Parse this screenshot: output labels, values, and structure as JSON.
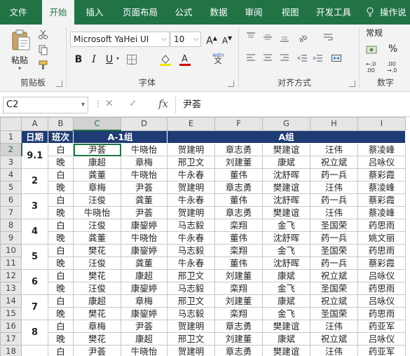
{
  "ribbon_tabs": [
    {
      "label": "文件",
      "active": false
    },
    {
      "label": "开始",
      "active": true
    },
    {
      "label": "插入",
      "active": false
    },
    {
      "label": "页面布局",
      "active": false
    },
    {
      "label": "公式",
      "active": false
    },
    {
      "label": "数据",
      "active": false
    },
    {
      "label": "审阅",
      "active": false
    },
    {
      "label": "视图",
      "active": false
    },
    {
      "label": "开发工具",
      "active": false
    }
  ],
  "tell_me": "操作说",
  "clipboard": {
    "paste_label": "粘贴",
    "group_label": "剪贴板"
  },
  "font": {
    "name": "Microsoft YaHei UI",
    "size": "10",
    "bold": "B",
    "italic": "I",
    "underline": "U",
    "grow": "A",
    "shrink": "A",
    "wen": "wén",
    "group_label": "字体"
  },
  "alignment": {
    "group_label": "对齐方式"
  },
  "number": {
    "format": "常规",
    "percent": "%",
    "group_label": "数字"
  },
  "formula_bar": {
    "name_box": "C2",
    "fx": "fx",
    "value": "尹荟"
  },
  "colors": {
    "accent": "#217346",
    "header_fill": "#1f3b73"
  },
  "columns": [
    "A",
    "B",
    "C",
    "D",
    "E",
    "F",
    "G",
    "H",
    "I"
  ],
  "rows": [
    "1",
    "2",
    "3",
    "4",
    "5",
    "6",
    "7",
    "8",
    "9",
    "10",
    "11",
    "12",
    "13",
    "14",
    "15",
    "16",
    "17",
    "18"
  ],
  "table": {
    "headers": {
      "date": "日期",
      "shift": "班次",
      "group_a1": "A-1组",
      "group_a": "A组"
    },
    "days": [
      {
        "date": "9.1",
        "shifts": [
          {
            "shift": "白",
            "names": [
              "尹荟",
              "牛晓怡",
              "贺建明",
              "章志勇",
              "樊建谊",
              "汪伟",
              "蔡凌峰"
            ]
          },
          {
            "shift": "晚",
            "names": [
              "康超",
              "章梅",
              "邢卫文",
              "刘建董",
              "康斌",
              "祝立斌",
              "吕咏仪"
            ]
          }
        ]
      },
      {
        "date": "2",
        "shifts": [
          {
            "shift": "白",
            "names": [
              "龚董",
              "牛晓怡",
              "牛永春",
              "董伟",
              "沈舒晖",
              "药一兵",
              "蔡彩霞"
            ]
          },
          {
            "shift": "晚",
            "names": [
              "章梅",
              "尹荟",
              "贺建明",
              "章志勇",
              "樊建谊",
              "汪伟",
              "蔡凌峰"
            ]
          }
        ]
      },
      {
        "date": "3",
        "shifts": [
          {
            "shift": "白",
            "names": [
              "汪俊",
              "龚董",
              "牛永春",
              "董伟",
              "沈舒晖",
              "药一兵",
              "蔡彩霞"
            ]
          },
          {
            "shift": "晚",
            "names": [
              "牛晓怡",
              "尹荟",
              "贺建明",
              "章志勇",
              "樊建谊",
              "汪伟",
              "蔡凌峰"
            ]
          }
        ]
      },
      {
        "date": "4",
        "shifts": [
          {
            "shift": "白",
            "names": [
              "汪俊",
              "康鋆婷",
              "马志毅",
              "栾翔",
              "金飞",
              "圣国荣",
              "药思雨"
            ]
          },
          {
            "shift": "晚",
            "names": [
              "龚董",
              "牛晓怡",
              "牛永春",
              "董伟",
              "沈舒晖",
              "药一兵",
              "姚文丽"
            ]
          }
        ]
      },
      {
        "date": "5",
        "shifts": [
          {
            "shift": "白",
            "names": [
              "樊花",
              "康鋆婷",
              "马志毅",
              "栾翔",
              "金飞",
              "圣国荣",
              "药思雨"
            ]
          },
          {
            "shift": "晚",
            "names": [
              "汪俊",
              "龚董",
              "牛永春",
              "董伟",
              "沈舒晖",
              "药一兵",
              "蔡彩霞"
            ]
          }
        ]
      },
      {
        "date": "6",
        "shifts": [
          {
            "shift": "白",
            "names": [
              "樊花",
              "康超",
              "邢卫文",
              "刘建董",
              "康斌",
              "祝立斌",
              "吕咏仪"
            ]
          },
          {
            "shift": "晚",
            "names": [
              "汪俊",
              "康鋆婷",
              "马志毅",
              "栾翔",
              "金飞",
              "圣国荣",
              "药思雨"
            ]
          }
        ]
      },
      {
        "date": "7",
        "shifts": [
          {
            "shift": "白",
            "names": [
              "康超",
              "章梅",
              "邢卫文",
              "刘建董",
              "康斌",
              "祝立斌",
              "吕咏仪"
            ]
          },
          {
            "shift": "晚",
            "names": [
              "樊花",
              "康鋆婷",
              "马志毅",
              "栾翔",
              "金飞",
              "圣国荣",
              "药思雨"
            ]
          }
        ]
      },
      {
        "date": "8",
        "shifts": [
          {
            "shift": "白",
            "names": [
              "章梅",
              "尹荟",
              "贺建明",
              "章志勇",
              "樊建谊",
              "汪伟",
              "药亚军"
            ]
          },
          {
            "shift": "晚",
            "names": [
              "樊花",
              "康超",
              "邢卫文",
              "刘建董",
              "康斌",
              "祝立斌",
              "吕咏仪"
            ]
          }
        ]
      },
      {
        "date": "",
        "shifts": [
          {
            "shift": "白",
            "names": [
              "尹荟",
              "牛晓怡",
              "贺建明",
              "章志勇",
              "樊建谊",
              "汪伟",
              "药亚军"
            ]
          }
        ]
      }
    ]
  }
}
